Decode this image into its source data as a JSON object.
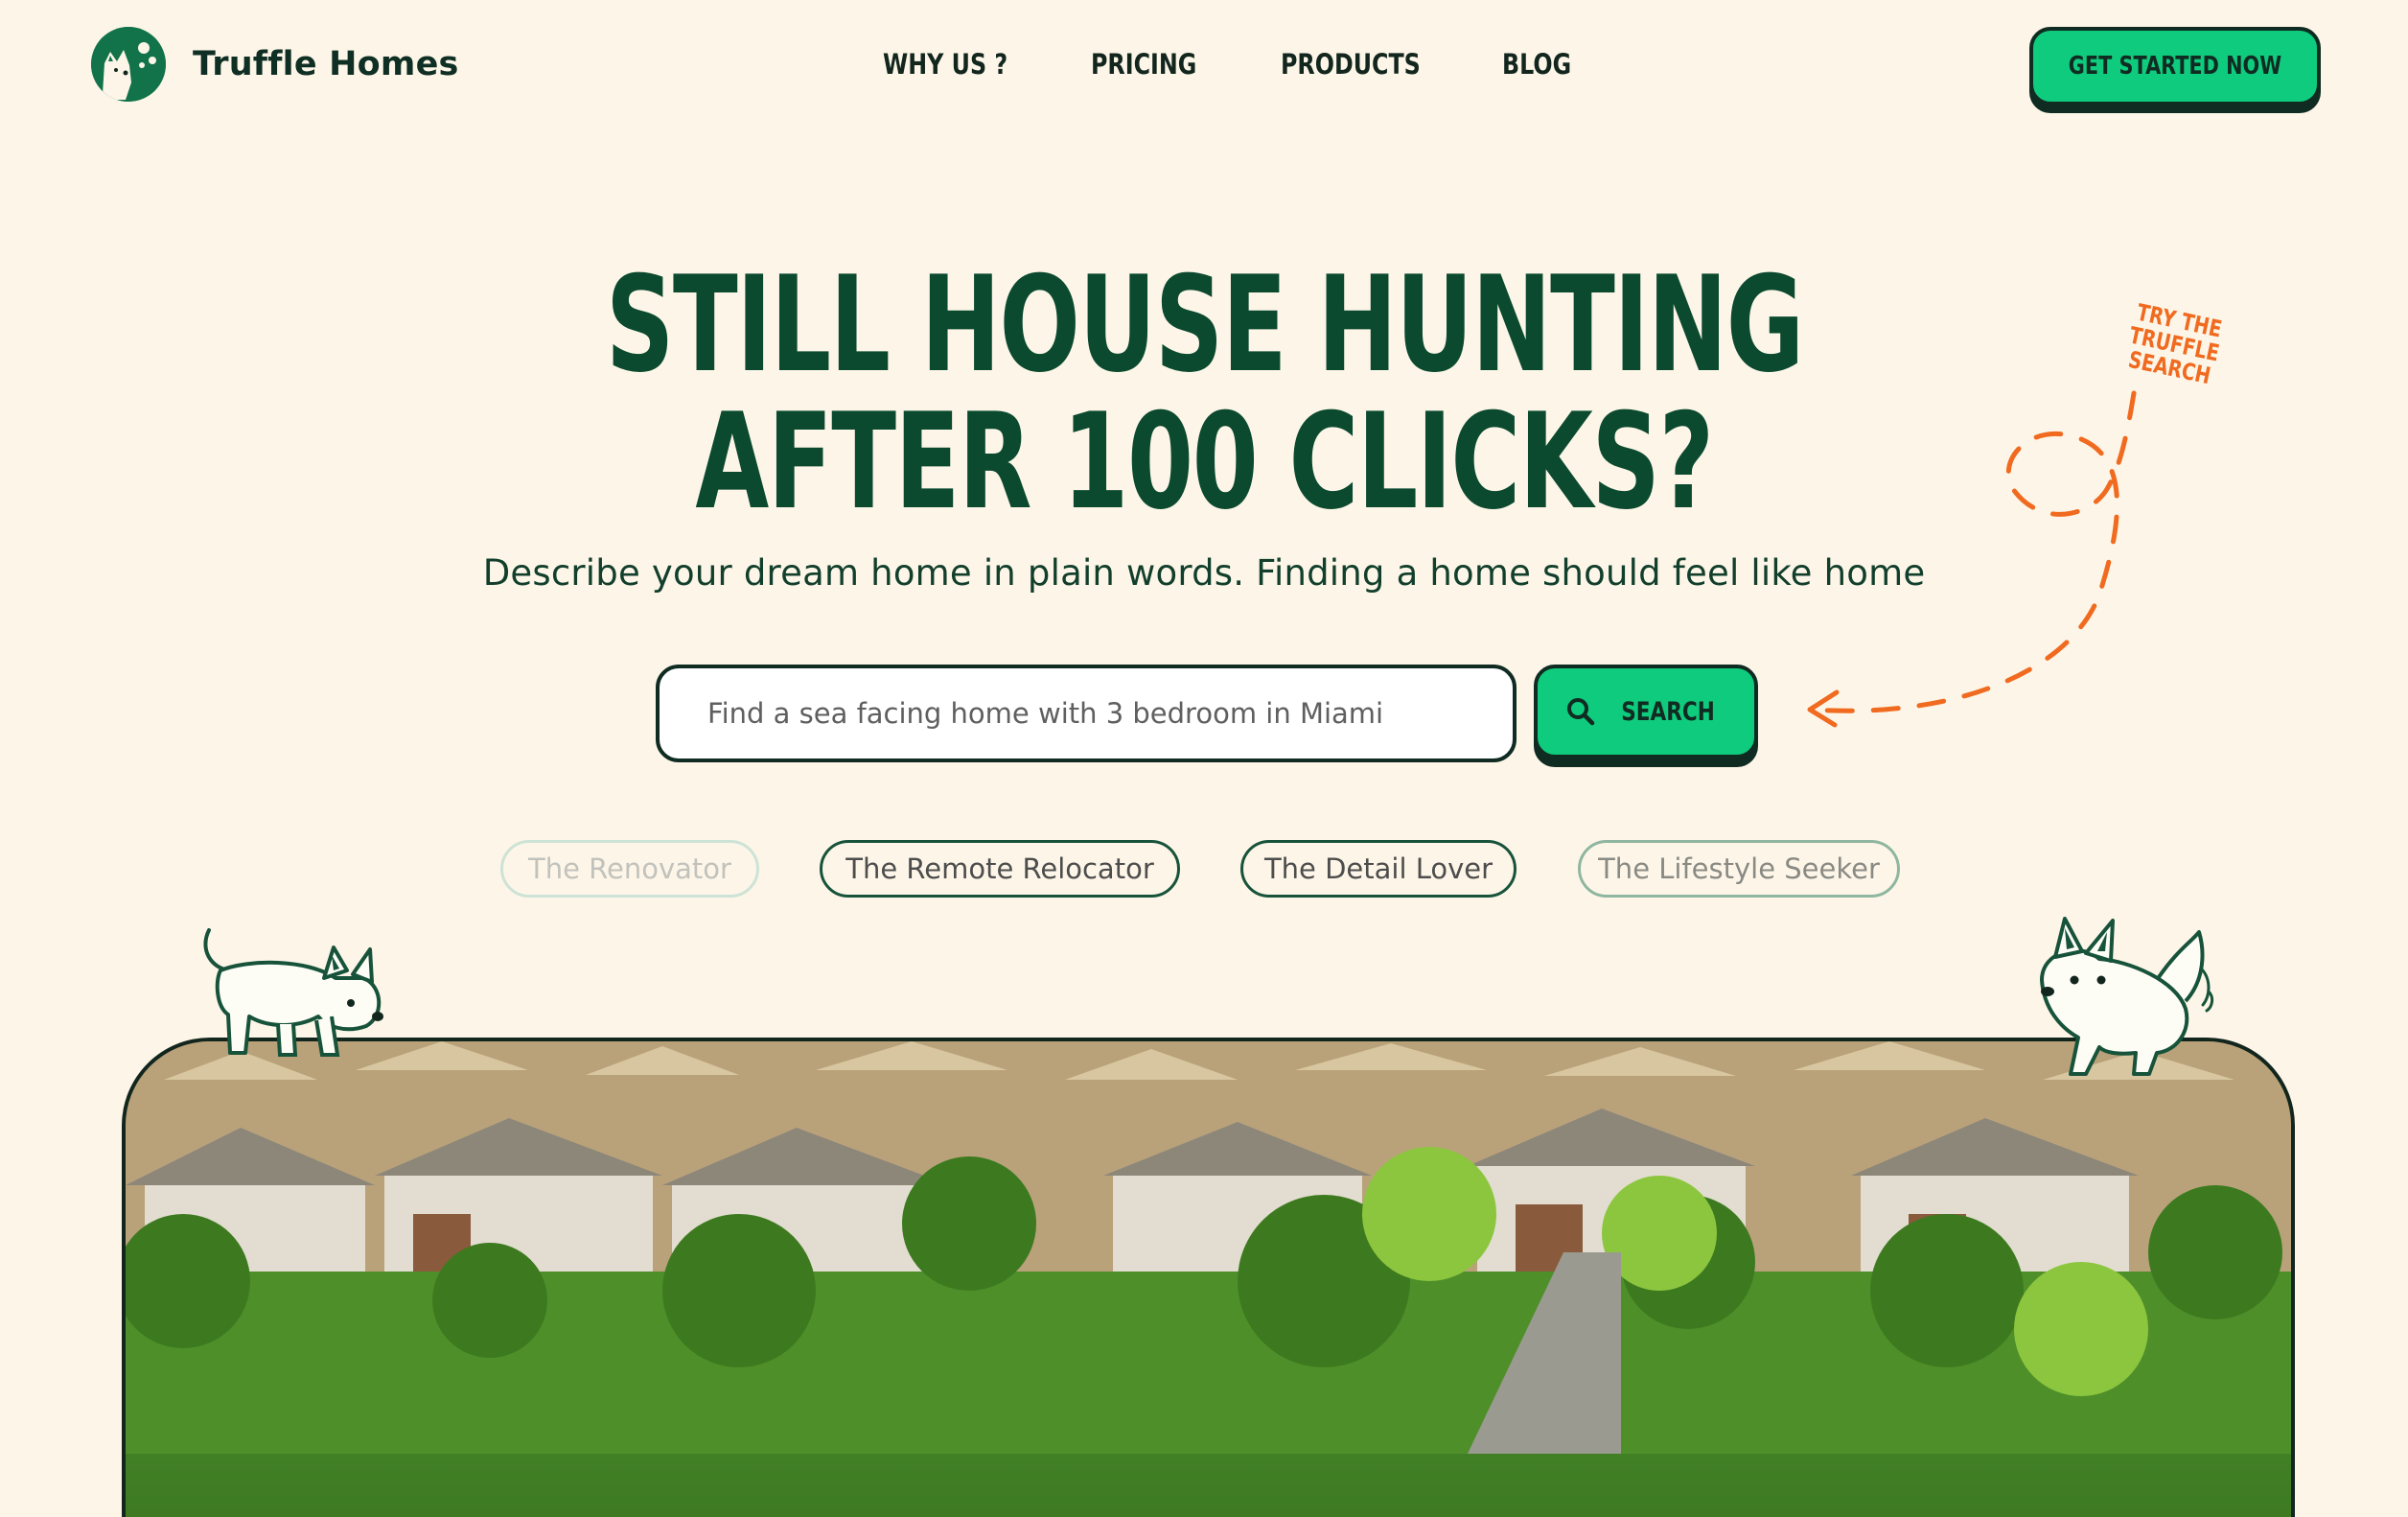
{
  "header": {
    "brand": "Truffle Homes",
    "nav": [
      "WHY US ?",
      "PRICING",
      "PRODUCTS",
      "BLOG"
    ],
    "cta_label": "GET STARTED NOW"
  },
  "hero": {
    "headline_line1": "STILL HOUSE HUNTING",
    "headline_line2": "AFTER 100 CLICKS?",
    "subheadline": "Describe your dream home in plain words. Finding a home should feel like home",
    "search_placeholder": "Find a sea facing home with 3 bedroom in Miami",
    "search_button": "SEARCH",
    "annotation_line1": "TRY THE TRUFFLE",
    "annotation_line2": "SEARCH"
  },
  "personas": [
    "The Renovator",
    "The Remote Relocator",
    "The Detail Lover",
    "The Lifestyle Seeker"
  ],
  "colors": {
    "background": "#fdf6e8",
    "brand_green": "#0b4a2f",
    "accent_green": "#0fcb7d",
    "annotation_orange": "#f06a1f",
    "outline": "#0f2b22"
  },
  "icons": {
    "logo": "dog-logo-icon",
    "search": "search-icon",
    "arrow": "dashed-arrow-icon",
    "mascot_left": "dog-mascot-icon",
    "mascot_right": "dog-mascot-icon"
  }
}
